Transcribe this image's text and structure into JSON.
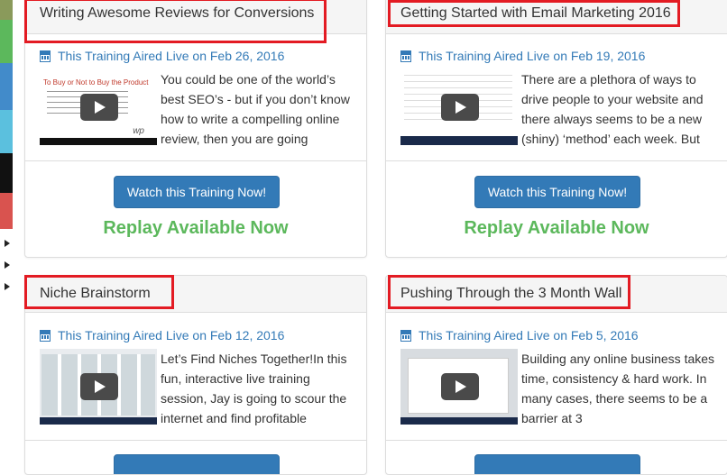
{
  "colors": {
    "accent": "#337ab7",
    "replay": "#5cb85c",
    "highlight": "#e31b23"
  },
  "cards": [
    {
      "title": "Writing Awesome Reviews for Conversions",
      "date": "This Training Aired Live on Feb 26, 2016",
      "thumb_text": "To Buy or Not to Buy the Product",
      "thumb_logo": "wp",
      "description": "You could be one of the world’s best SEO’s - but if you don’t know how to write a compelling online review, then you are going",
      "button": "Watch this Training Now!",
      "replay": "Replay Available Now"
    },
    {
      "title": "Getting Started with Email Marketing 2016",
      "date": "This Training Aired Live on Feb 19, 2016",
      "description": "There are a plethora of ways to drive people to your website and there always seems to be a new (shiny) ‘method’ each week. But",
      "button": "Watch this Training Now!",
      "replay": "Replay Available Now"
    },
    {
      "title": "Niche Brainstorm",
      "date": "This Training Aired Live on Feb 12, 2016",
      "description": "Let’s Find Niches Together!In this fun, interactive live training session, Jay is going to scour the internet and find profitable"
    },
    {
      "title": "Pushing Through the 3 Month Wall",
      "date": "This Training Aired Live on Feb 5, 2016",
      "description": "Building any online business takes time, consistency & hard work. In many cases, there seems to be a barrier at 3"
    }
  ]
}
